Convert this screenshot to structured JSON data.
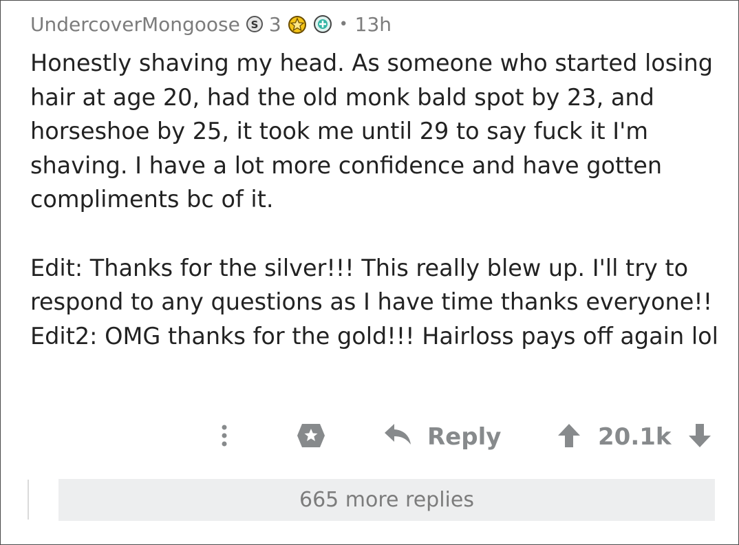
{
  "comment": {
    "username": "UndercoverMongoose",
    "flair_count": "3",
    "separator": "•",
    "time_ago": "13h",
    "awards": [
      "silver-award-icon",
      "gold-award-icon",
      "wholesome-award-icon"
    ],
    "paragraphs": [
      "Honestly shaving my head. As someone who started losing hair at age 20, had the old monk bald spot by 23, and horseshoe by 25, it took me until 29 to say fuck it I'm shaving. I have a lot more confidence and have gotten compliments bc of it.",
      "Edit: Thanks for the silver!!! This really blew up. I'll try to respond to any questions as I have time thanks everyone!! Edit2: OMG thanks for the gold!!! Hairloss pays off again lol"
    ]
  },
  "actions": {
    "more_icon": "more-options-icon",
    "award_icon": "give-award-icon",
    "reply_icon": "reply-arrow-icon",
    "reply_label": "Reply",
    "score": "20.1k",
    "upvote_icon": "upvote-icon",
    "downvote_icon": "downvote-icon"
  },
  "thread": {
    "more_replies_label": "665 more replies"
  },
  "colors": {
    "meta_gray": "#7c7c7c",
    "action_gray": "#878a8c",
    "more_replies_bg": "#edeeef",
    "gold": "#f5c518",
    "teal": "#35b6a5"
  }
}
